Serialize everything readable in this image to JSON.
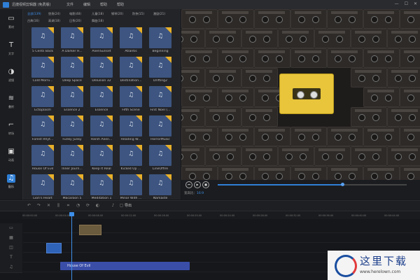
{
  "app": {
    "title": "迅捷视频剪辑器 (免费版)"
  },
  "menu": [
    "文件",
    "编辑",
    "帮助",
    "帮助"
  ],
  "window_controls": [
    "—",
    "☐",
    "✕"
  ],
  "sidebar": [
    {
      "label": "素材",
      "icon": "folder-icon"
    },
    {
      "label": "文字",
      "icon": "text-icon"
    },
    {
      "label": "滤镜",
      "icon": "filter-icon"
    },
    {
      "label": "叠附",
      "icon": "layers-icon"
    },
    {
      "label": "转场",
      "icon": "transition-icon"
    },
    {
      "label": "动画",
      "icon": "animation-icon"
    },
    {
      "label": "配乐",
      "icon": "music-icon",
      "active": true
    }
  ],
  "categories_row1": [
    "全部(139)",
    "悠扬(24)",
    "电影(48)",
    "儿童(18)",
    "钢琴(20)",
    "防快(15)",
    "激励(21)"
  ],
  "categories_row2": [
    "古典(16)",
    "高调(18)",
    "日系(20)",
    "舞曲(18)"
  ],
  "tracks": [
    [
      "5 Cents Back",
      "A Darker H...",
      "AlienSunset",
      "Atlantis",
      "Beginning"
    ],
    [
      "Cold Morni...",
      "Deep Space",
      "Delusion 32",
      "Destination...",
      "Drifting2"
    ],
    [
      "Ectoplasm",
      "Essence 2",
      "Essence",
      "Fifth Scene",
      "First Noel (..."
    ],
    [
      "Forest Rhyt...",
      "Funky Junky",
      "Harsh Alien...",
      "Heading W...",
      "HorrorMusic"
    ],
    [
      "House Of Evil",
      "Inner Journ...",
      "Keep It Real",
      "Kicked Up ...",
      "LineOffire"
    ],
    [
      "Lion's Heart",
      "Macaroon 5",
      "Meditation 1",
      "Minor With ...",
      "Namaste"
    ]
  ],
  "player": {
    "ratio_label": "宽高比：",
    "ratio_value": "16:9",
    "progress": 0.66
  },
  "toolbar": {
    "export_label": "导出"
  },
  "ruler": [
    "00:00:00.00",
    "00:00:04.00",
    "00:00:08.00",
    "00:00:12.00",
    "00:00:16.00",
    "00:00:20.00",
    "00:00:24.00",
    "00:00:28.00",
    "00:00:32.00",
    "00:00:36.00",
    "00:00:40.00",
    "00:00:44.00"
  ],
  "timeline": {
    "audio_clip": "House Of Evil"
  },
  "watermark": {
    "text": "这里下载",
    "url": "www.herelown.com"
  }
}
